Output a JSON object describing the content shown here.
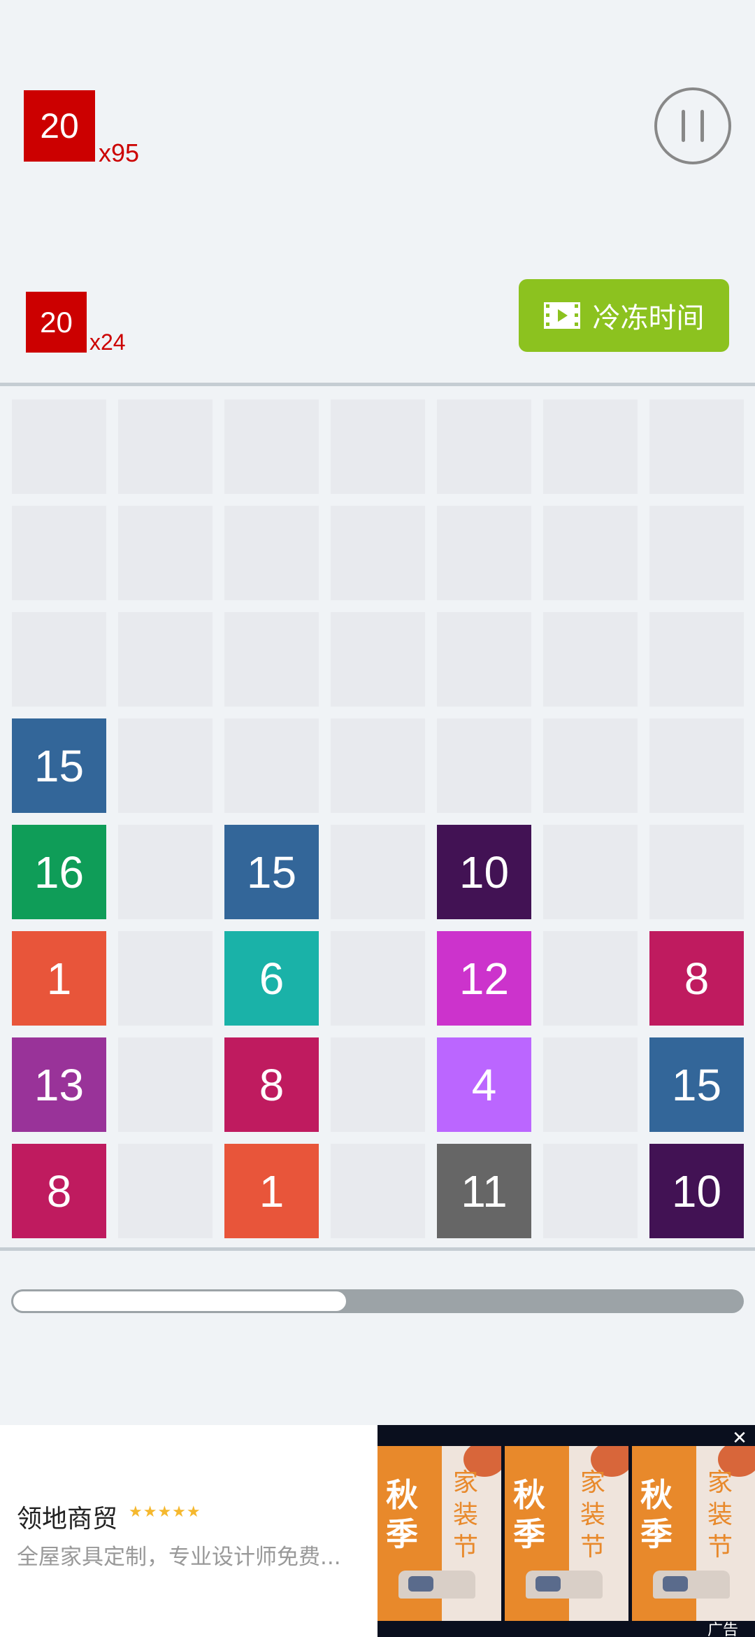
{
  "targets": {
    "primary": {
      "value": "20",
      "multiplier": "x95",
      "color": "#cc0000"
    },
    "secondary": {
      "value": "20",
      "multiplier": "x24",
      "color": "#cc0000"
    }
  },
  "controls": {
    "pause_icon": "pause-icon",
    "freeze_label": "冷冻时间",
    "freeze_icon": "video-film-icon",
    "freeze_color": "#8cc21f"
  },
  "board": {
    "columns": 7,
    "rows": 8,
    "tiles": [
      {
        "row": 3,
        "col": 0,
        "value": "15",
        "color": "#336699"
      },
      {
        "row": 4,
        "col": 0,
        "value": "16",
        "color": "#0f9d58"
      },
      {
        "row": 4,
        "col": 2,
        "value": "15",
        "color": "#336699"
      },
      {
        "row": 4,
        "col": 4,
        "value": "10",
        "color": "#421254"
      },
      {
        "row": 5,
        "col": 0,
        "value": "1",
        "color": "#e8553a"
      },
      {
        "row": 5,
        "col": 2,
        "value": "6",
        "color": "#1ab2a8"
      },
      {
        "row": 5,
        "col": 4,
        "value": "12",
        "color": "#cc33cc"
      },
      {
        "row": 5,
        "col": 6,
        "value": "8",
        "color": "#bf1b5f"
      },
      {
        "row": 6,
        "col": 0,
        "value": "13",
        "color": "#993399"
      },
      {
        "row": 6,
        "col": 2,
        "value": "8",
        "color": "#bf1b5f"
      },
      {
        "row": 6,
        "col": 4,
        "value": "4",
        "color": "#bb66ff"
      },
      {
        "row": 6,
        "col": 6,
        "value": "15",
        "color": "#336699"
      },
      {
        "row": 7,
        "col": 0,
        "value": "8",
        "color": "#bf1b5f"
      },
      {
        "row": 7,
        "col": 2,
        "value": "1",
        "color": "#e8553a"
      },
      {
        "row": 7,
        "col": 4,
        "value": "11",
        "color": "#666666"
      },
      {
        "row": 7,
        "col": 6,
        "value": "10",
        "color": "#421254"
      }
    ]
  },
  "progress": {
    "fraction": 0.46
  },
  "ad": {
    "title": "领地商贸",
    "stars": "★★★★★",
    "description": "全屋家具定制，专业设计师免费...",
    "image_text_big1": "秋",
    "image_text_big2": "季",
    "image_text_side": "家装节",
    "close_symbol": "✕",
    "label": "广告"
  }
}
